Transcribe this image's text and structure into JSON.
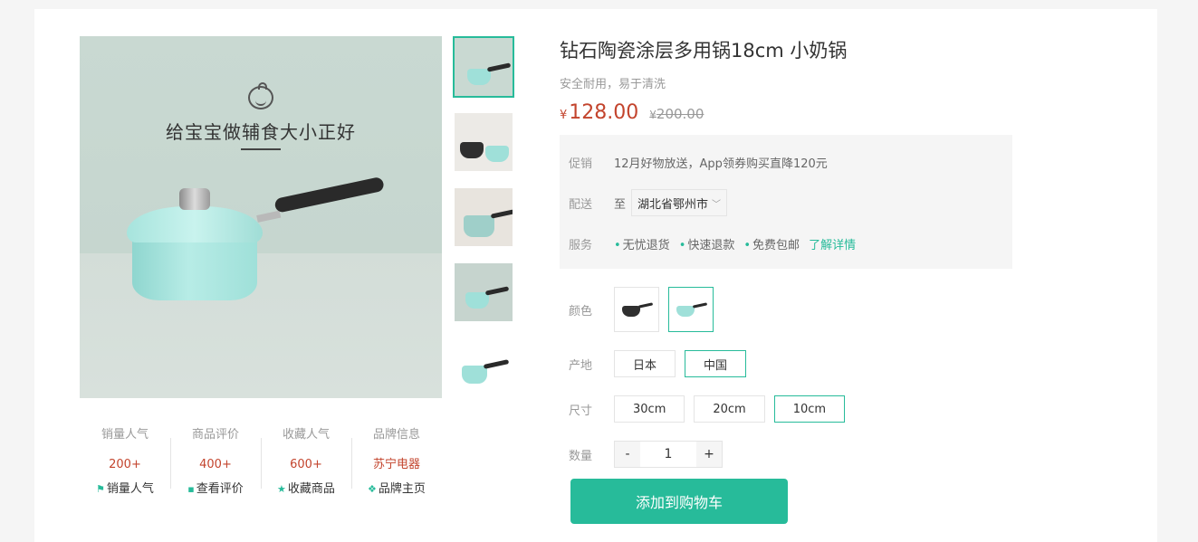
{
  "product": {
    "title": "钻石陶瓷涂层多用锅18cm 小奶锅",
    "subtitle": "安全耐用，易于清洗",
    "currency": "¥",
    "price_now": "128.00",
    "price_old": "200.00",
    "image_headline": "给宝宝做辅食大小正好"
  },
  "info": {
    "promo_label": "促销",
    "promo_text": "12月好物放送，App领券购买直降120元",
    "shipping_label": "配送",
    "shipping_to": "至",
    "shipping_address": "湖北省鄂州市",
    "service_label": "服务",
    "services": [
      "无忧退货",
      "快速退款",
      "免费包邮"
    ],
    "service_more": "了解详情"
  },
  "specs": {
    "color_label": "颜色",
    "colors": [
      {
        "name": "black-pot",
        "selected": false,
        "pot_color": "#2f2f2f"
      },
      {
        "name": "mint-pot",
        "selected": true,
        "pot_color": "#9fe0d9"
      }
    ],
    "origin_label": "产地",
    "origins": [
      {
        "label": "日本",
        "selected": false
      },
      {
        "label": "中国",
        "selected": true
      }
    ],
    "size_label": "尺寸",
    "sizes": [
      {
        "label": "30cm",
        "selected": false
      },
      {
        "label": "20cm",
        "selected": false
      },
      {
        "label": "10cm",
        "selected": true
      }
    ],
    "qty_label": "数量",
    "qty_minus": "-",
    "qty_value": "1",
    "qty_plus": "+"
  },
  "cart_button": "添加到购物车",
  "stats": [
    {
      "title": "销量人气",
      "value": "200+",
      "link": "销量人气",
      "icon": "flag-icon",
      "glyph": "⚑"
    },
    {
      "title": "商品评价",
      "value": "400+",
      "link": "查看评价",
      "icon": "comment-icon",
      "glyph": "▪"
    },
    {
      "title": "收藏人气",
      "value": "600+",
      "link": "收藏商品",
      "icon": "star-icon",
      "glyph": "★"
    },
    {
      "title": "品牌信息",
      "value": "苏宁电器",
      "link": "品牌主页",
      "icon": "brand-icon",
      "glyph": "❖"
    }
  ],
  "thumbnails": [
    {
      "name": "thumb-1",
      "active": true
    },
    {
      "name": "thumb-2",
      "active": false
    },
    {
      "name": "thumb-3",
      "active": false
    },
    {
      "name": "thumb-4",
      "active": false
    },
    {
      "name": "thumb-5",
      "active": false
    }
  ],
  "colors": {
    "accent": "#27bb9a",
    "price": "#c3442d"
  }
}
